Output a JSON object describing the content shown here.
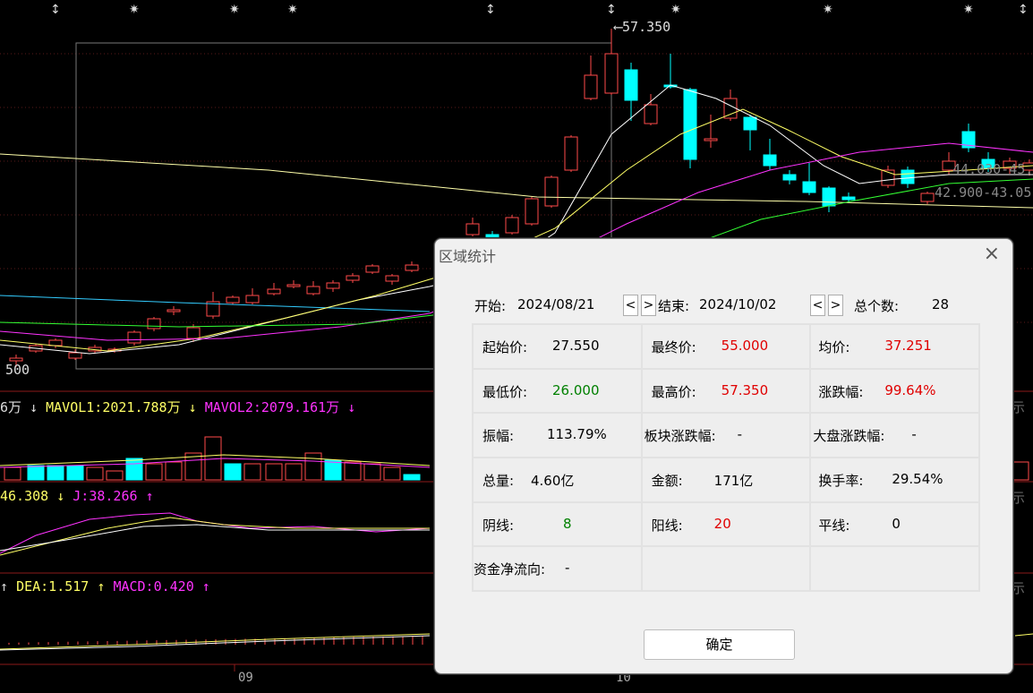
{
  "chart": {
    "high_marker": "57.350",
    "price_label_500": "500",
    "ma_label_1": "44.030-45.5",
    "ma_label_2": "42.900-43.05",
    "x_label_09": "09",
    "x_label_10": "10",
    "right_label_1": "示",
    "right_label_2": "示",
    "right_label_3": "示",
    "colors": {
      "up": "#ff4a4a",
      "down": "#00ffff",
      "ma5": "#ffffff",
      "ma10": "#ffff66",
      "ma20": "#ff33ff",
      "ma60": "#33ff33",
      "ma120": "#ffffaa"
    }
  },
  "vol_header": {
    "prefix": "6万",
    "mavol1": "MAVOL1:2021.788万",
    "mavol2": "MAVOL2:2079.161万"
  },
  "kdj_header": {
    "d": "46.308",
    "j": "J:38.266"
  },
  "macd_header": {
    "dea": "DEA:1.517",
    "macd": "MACD:0.420"
  },
  "dialog": {
    "title": "区域统计",
    "start_label": "开始:",
    "start_date": "2024/08/21",
    "end_label": "结束:",
    "end_date": "2024/10/02",
    "prev": "<",
    "next": ">",
    "total_label": "总个数:",
    "total_value": "28",
    "cells": {
      "open_label": "起始价:",
      "open_value": "27.550",
      "close_label": "最终价:",
      "close_value": "55.000",
      "avg_label": "均价:",
      "avg_value": "37.251",
      "low_label": "最低价:",
      "low_value": "26.000",
      "high_label": "最高价:",
      "high_value": "57.350",
      "chg_label": "涨跌幅:",
      "chg_value": "99.64%",
      "amp_label": "振幅:",
      "amp_value": "113.79%",
      "sector_label": "板块涨跌幅:",
      "sector_value": "-",
      "market_label": "大盘涨跌幅:",
      "market_value": "-",
      "vol_label": "总量:",
      "vol_value": "4.60亿",
      "amount_label": "金额:",
      "amount_value": "171亿",
      "turnover_label": "换手率:",
      "turnover_value": "29.54%",
      "yin_label": "阴线:",
      "yin_value": "8",
      "yang_label": "阳线:",
      "yang_value": "20",
      "flat_label": "平线:",
      "flat_value": "0",
      "flow_label": "资金净流向:",
      "flow_value": "-"
    },
    "ok": "确定",
    "close_icon": "×"
  }
}
